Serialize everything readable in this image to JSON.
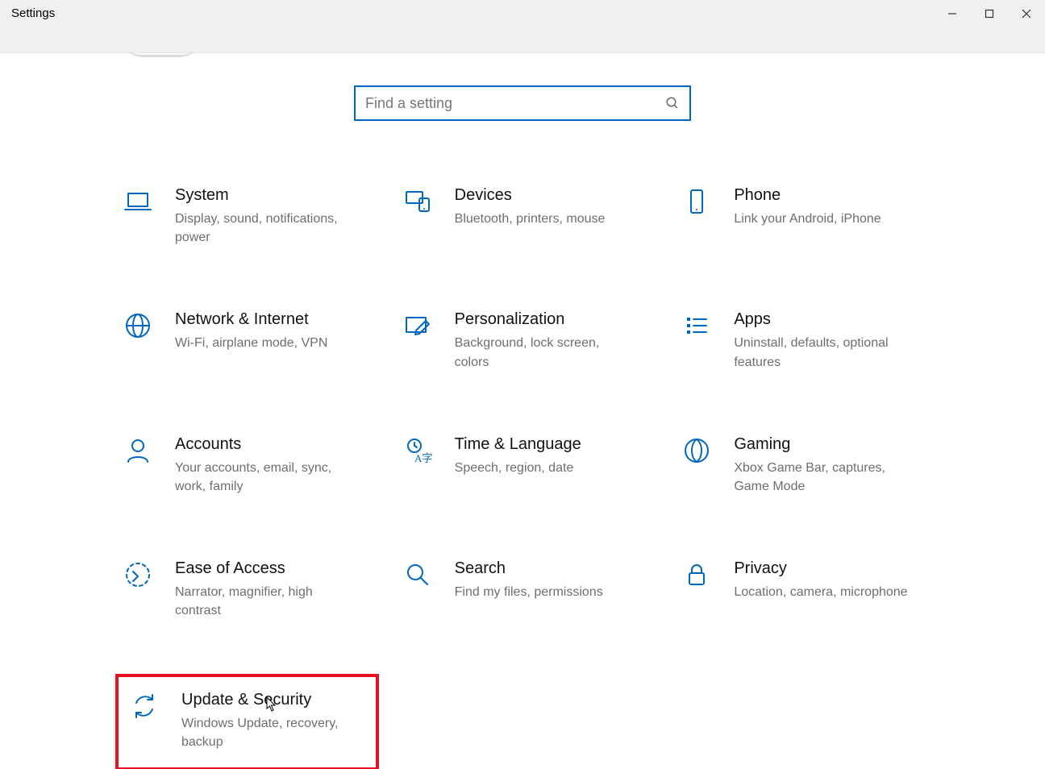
{
  "colors": {
    "accent": "#0067c0",
    "highlight": "#e81123"
  },
  "titlebar": {
    "title": "Settings"
  },
  "search": {
    "placeholder": "Find a setting"
  },
  "tiles": [
    {
      "id": "system",
      "icon": "laptop",
      "title": "System",
      "sub": "Display, sound, notifications, power"
    },
    {
      "id": "devices",
      "icon": "devices",
      "title": "Devices",
      "sub": "Bluetooth, printers, mouse"
    },
    {
      "id": "phone",
      "icon": "phone",
      "title": "Phone",
      "sub": "Link your Android, iPhone"
    },
    {
      "id": "network",
      "icon": "globe",
      "title": "Network & Internet",
      "sub": "Wi-Fi, airplane mode, VPN"
    },
    {
      "id": "personalization",
      "icon": "pen",
      "title": "Personalization",
      "sub": "Background, lock screen, colors"
    },
    {
      "id": "apps",
      "icon": "list",
      "title": "Apps",
      "sub": "Uninstall, defaults, optional features"
    },
    {
      "id": "accounts",
      "icon": "person",
      "title": "Accounts",
      "sub": "Your accounts, email, sync, work, family"
    },
    {
      "id": "time-language",
      "icon": "time-lang",
      "title": "Time & Language",
      "sub": "Speech, region, date"
    },
    {
      "id": "gaming",
      "icon": "gaming",
      "title": "Gaming",
      "sub": "Xbox Game Bar, captures, Game Mode"
    },
    {
      "id": "ease-of-access",
      "icon": "ease",
      "title": "Ease of Access",
      "sub": "Narrator, magnifier, high contrast"
    },
    {
      "id": "search",
      "icon": "search",
      "title": "Search",
      "sub": "Find my files, permissions"
    },
    {
      "id": "privacy",
      "icon": "lock",
      "title": "Privacy",
      "sub": "Location, camera, microphone"
    },
    {
      "id": "update-security",
      "icon": "sync",
      "title": "Update & Security",
      "sub": "Windows Update, recovery, backup",
      "highlighted": true
    }
  ]
}
